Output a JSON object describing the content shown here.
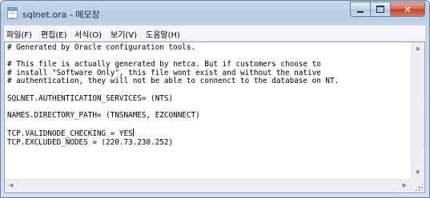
{
  "window": {
    "title": "sqlnet.ora - 메모장"
  },
  "menu": {
    "items": [
      {
        "label": "파일(F)"
      },
      {
        "label": "편집(E)"
      },
      {
        "label": "서식(O)"
      },
      {
        "label": "보기(V)"
      },
      {
        "label": "도움말(H)"
      }
    ]
  },
  "editor": {
    "lines": [
      "# Generated by Oracle configuration tools.",
      "",
      "# This file is actually generated by netca. But if customers choose to",
      "# install \"Software Only\", this file wont exist and without the native",
      "# authentication, they will not be able to connenct to the database on NT.",
      "",
      "SQLNET.AUTHENTICATION_SERVICES= (NTS)",
      "",
      "NAMES.DIRECTORY_PATH= (TNSNAMES, EZCONNECT)",
      "",
      "TCP.VALIDNODE_CHECKING = YES",
      "TCP.EXCLUDED_NODES = (220.73.230.252)"
    ]
  },
  "icons": {
    "app": "notepad-icon",
    "minimize": "minimize-icon",
    "maximize": "maximize-icon",
    "close": "close-icon",
    "scroll_up": "scroll-up-arrow-icon",
    "scroll_down": "scroll-down-arrow-icon",
    "scroll_left": "scroll-left-arrow-icon",
    "scroll_right": "scroll-right-arrow-icon",
    "grip": "resize-grip-icon"
  },
  "colors": {
    "titlebar": "#c4d4ea",
    "close_button": "#c94a33",
    "editor_background": "#ffffff"
  }
}
